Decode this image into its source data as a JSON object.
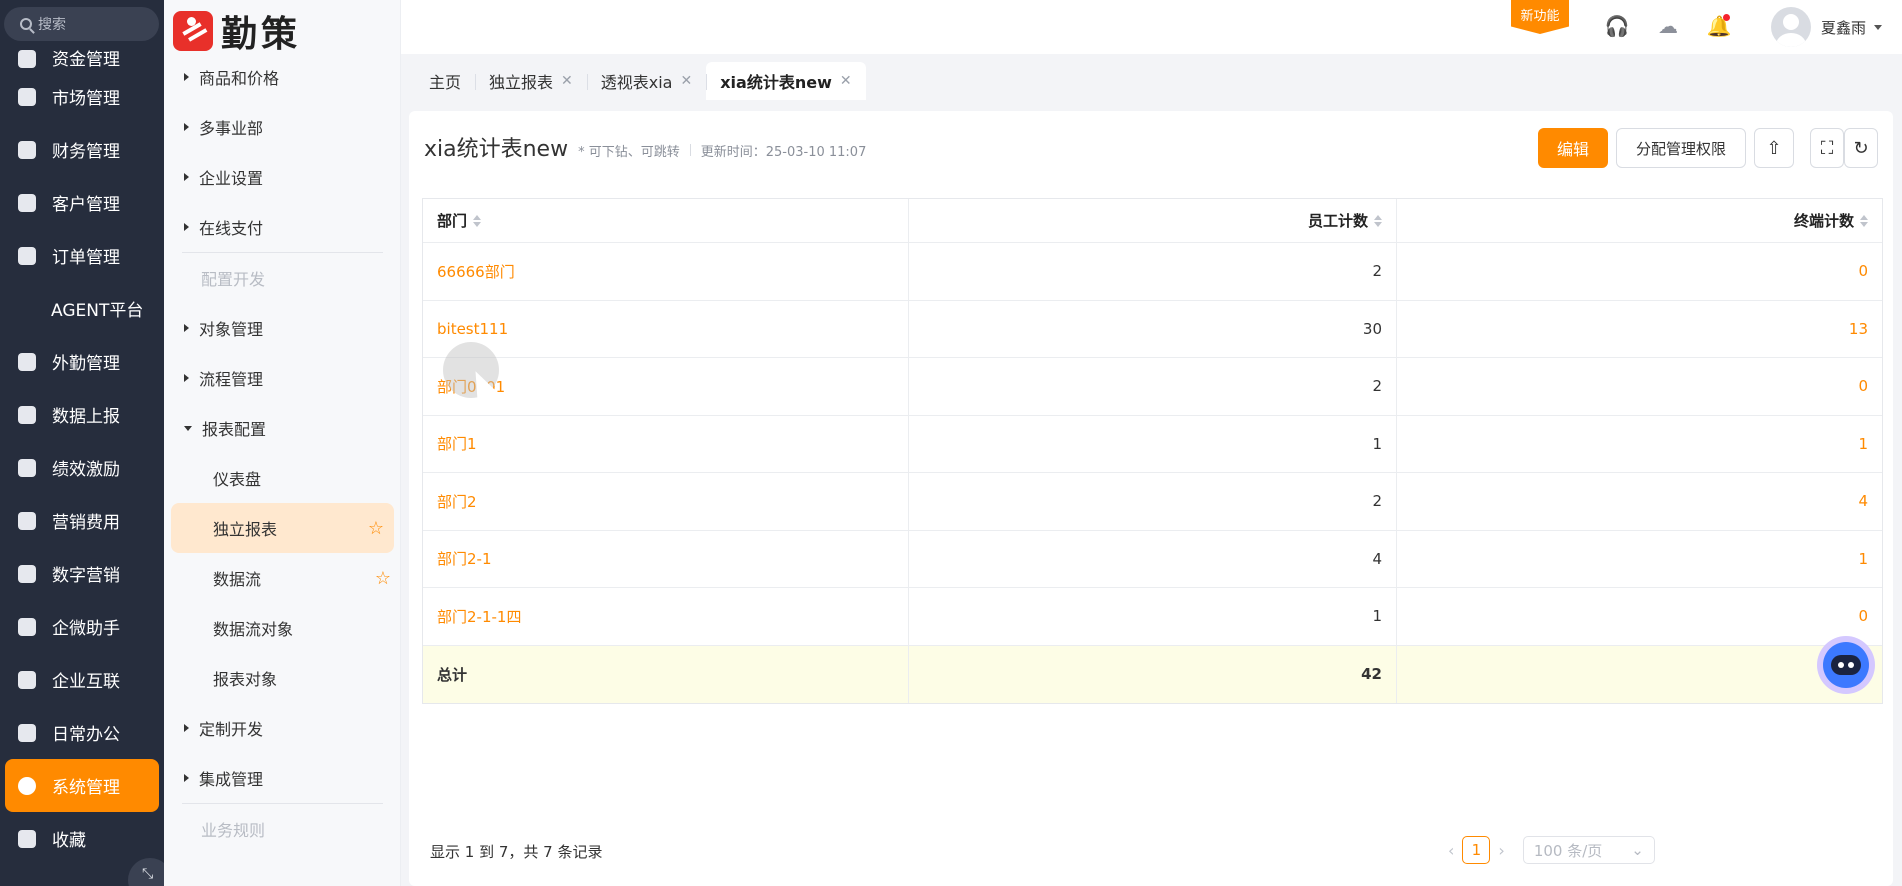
{
  "search": {
    "placeholder": "搜索"
  },
  "main_nav": [
    {
      "label": "资金管理",
      "icon": "wallet-icon"
    },
    {
      "label": "市场管理",
      "icon": "compass-icon"
    },
    {
      "label": "财务管理",
      "icon": "yen-icon"
    },
    {
      "label": "客户管理",
      "icon": "building-icon"
    },
    {
      "label": "订单管理",
      "icon": "clipboard-icon"
    },
    {
      "label": "AGENT平台",
      "icon": ""
    },
    {
      "label": "外勤管理",
      "icon": "location-icon"
    },
    {
      "label": "数据上报",
      "icon": "report-icon"
    },
    {
      "label": "绩效激励",
      "icon": "medal-icon"
    },
    {
      "label": "营销费用",
      "icon": "receipt-icon"
    },
    {
      "label": "数字营销",
      "icon": "store-icon"
    },
    {
      "label": "企微助手",
      "icon": "chat-icon"
    },
    {
      "label": "企业互联",
      "icon": "link-icon"
    },
    {
      "label": "日常办公",
      "icon": "briefcase-icon"
    },
    {
      "label": "系统管理",
      "icon": "gear-icon"
    },
    {
      "label": "收藏",
      "icon": "star-icon"
    }
  ],
  "brand": {
    "name": "勤策"
  },
  "sub_nav": {
    "items": [
      "商品和价格",
      "多事业部",
      "企业设置",
      "在线支付",
      "配置开发",
      "对象管理",
      "流程管理",
      "报表配置",
      "仪表盘",
      "独立报表",
      "数据流",
      "数据流对象",
      "报表对象",
      "定制开发",
      "集成管理",
      "业务规则"
    ]
  },
  "header": {
    "new_feature": "新功能",
    "user_name": "夏鑫雨"
  },
  "tabs": [
    "主页",
    "独立报表",
    "透视表xia",
    "xia统计表new"
  ],
  "page": {
    "title": "xia统计表new",
    "hint": "* 可下钻、可跳转",
    "updated": "更新时间：25-03-10 11:07",
    "edit_label": "编辑",
    "perm_label": "分配管理权限"
  },
  "table": {
    "columns": [
      "部门",
      "员工计数",
      "终端计数"
    ],
    "rows": [
      [
        "66666部门",
        "2",
        "0"
      ],
      [
        "bitest111",
        "30",
        "13"
      ],
      [
        "部门0001",
        "2",
        "0"
      ],
      [
        "部门1",
        "1",
        "1"
      ],
      [
        "部门2",
        "2",
        "4"
      ],
      [
        "部门2-1",
        "4",
        "1"
      ],
      [
        "部门2-1-1四",
        "1",
        "0"
      ]
    ],
    "total": [
      "总计",
      "42",
      ""
    ]
  },
  "pagination": {
    "info": "显示 1 到 7，共 7 条记录",
    "page": "1",
    "page_size": "100 条/页"
  },
  "colors": {
    "accent": "#ff8a00",
    "sidebar": "#262d3d"
  }
}
